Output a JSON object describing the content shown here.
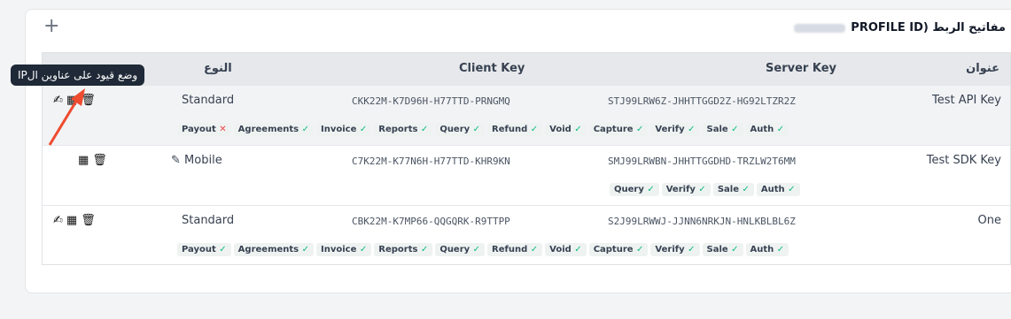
{
  "header": {
    "add_label": "+",
    "title_prefix": "مفاتيح الربط (",
    "title_suffix": "PROFILE ID"
  },
  "columns": {
    "address": "عنوان",
    "server_key": "Server Key",
    "client_key": "Client Key",
    "type": "النوع"
  },
  "tooltip": "وضع قيود على عناوين الIP",
  "rows": [
    {
      "name": "Test API Key",
      "server_key": "STJ99LRW6Z-JHHTTGGD2Z-HG92LTZR2Z",
      "client_key": "CKK22M-K7D96H-H77TTD-PRNGMQ",
      "type": "Standard",
      "badges": [
        "Payout",
        "Agreements",
        "Invoice",
        "Reports",
        "Query",
        "Refund",
        "Void",
        "Capture",
        "Verify",
        "Sale",
        "Auth"
      ],
      "status": [
        "✕",
        "✓",
        "✓",
        "✓",
        "✓",
        "✓",
        "✓",
        "✓",
        "✓",
        "✓",
        "✓"
      ]
    },
    {
      "name": "Test SDK Key",
      "server_key": "SMJ99LRWBN-JHHTTGGDHD-TRZLW2T6MM",
      "client_key": "C7K22M-K77N6H-H77TTD-KHR9KN",
      "type": "Mobile",
      "badges": [
        "Query",
        "Verify",
        "Sale",
        "Auth"
      ],
      "status": [
        "✓",
        "✓",
        "✓",
        "✓"
      ]
    },
    {
      "name": "One",
      "server_key": "S2J99LRWWJ-JJNN6NRKJN-HNLKBLBL6Z",
      "client_key": "CBK22M-K7MP66-QQGQRK-R9TTPP",
      "type": "Standard",
      "badges": [
        "Payout",
        "Agreements",
        "Invoice",
        "Reports",
        "Query",
        "Refund",
        "Void",
        "Capture",
        "Verify",
        "Sale",
        "Auth"
      ],
      "status": [
        "✓",
        "✓",
        "✓",
        "✓",
        "✓",
        "✓",
        "✓",
        "✓",
        "✓",
        "✓",
        "✓"
      ]
    }
  ],
  "colors": {
    "ok": "#10b981",
    "bad": "#ef4444",
    "arrow": "#ef4b2f"
  },
  "icons": {
    "signature": "signature-icon",
    "ip": "ip-restrict-icon",
    "trash": "trash-icon",
    "mobile": "mobile-edit-icon"
  }
}
